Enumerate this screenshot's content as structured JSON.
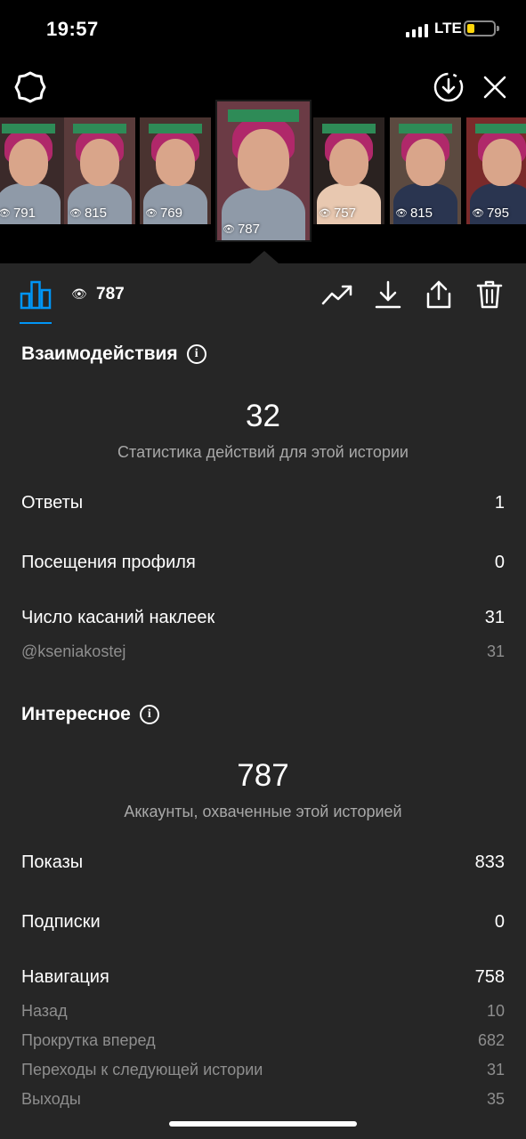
{
  "status_bar": {
    "time": "19:57",
    "network": "LTE",
    "battery_level": 0.3,
    "battery_color": "#ffd60a"
  },
  "top_bar": {
    "settings_icon": "gear-icon",
    "download_icon": "download-circle-icon",
    "close_icon": "close-icon"
  },
  "stories": [
    {
      "views": "791",
      "active": false,
      "bg": "#3b2a2a",
      "shirt": "#8f9aa8"
    },
    {
      "views": "815",
      "active": false,
      "bg": "#5a3b3b",
      "shirt": "#8f9aa8"
    },
    {
      "views": "769",
      "active": false,
      "bg": "#4a3330",
      "shirt": "#8f9aa8"
    },
    {
      "views": "787",
      "active": true,
      "bg": "#6b3b45",
      "shirt": "#8f9aa8"
    },
    {
      "views": "757",
      "active": false,
      "bg": "#2a2220",
      "shirt": "#e8c8b0"
    },
    {
      "views": "815",
      "active": false,
      "bg": "#5c4a40",
      "shirt": "#2a3550"
    },
    {
      "views": "795",
      "active": false,
      "bg": "#7a2a2a",
      "shirt": "#2a3550"
    }
  ],
  "toolbar": {
    "views": "787",
    "chart_icon": "bar-chart-icon",
    "trend_icon": "trending-icon",
    "save_icon": "download-icon",
    "share_icon": "share-icon",
    "delete_icon": "trash-icon",
    "accent": "#0095f6"
  },
  "interactions": {
    "title": "Взаимодействия",
    "total": "32",
    "caption": "Статистика действий для этой истории",
    "rows": [
      {
        "label": "Ответы",
        "value": "1"
      },
      {
        "label": "Посещения профиля",
        "value": "0"
      },
      {
        "label": "Число касаний наклеек",
        "value": "31"
      }
    ],
    "sticker_sub": {
      "label": "@kseniakostej",
      "value": "31"
    }
  },
  "discovery": {
    "title": "Интересное",
    "total": "787",
    "caption": "Аккаунты, охваченные этой историей",
    "rows": [
      {
        "label": "Показы",
        "value": "833"
      },
      {
        "label": "Подписки",
        "value": "0"
      },
      {
        "label": "Навигация",
        "value": "758"
      }
    ],
    "navigation_sub": [
      {
        "label": "Назад",
        "value": "10"
      },
      {
        "label": "Прокрутка вперед",
        "value": "682"
      },
      {
        "label": "Переходы к следующей истории",
        "value": "31"
      },
      {
        "label": "Выходы",
        "value": "35"
      }
    ]
  }
}
